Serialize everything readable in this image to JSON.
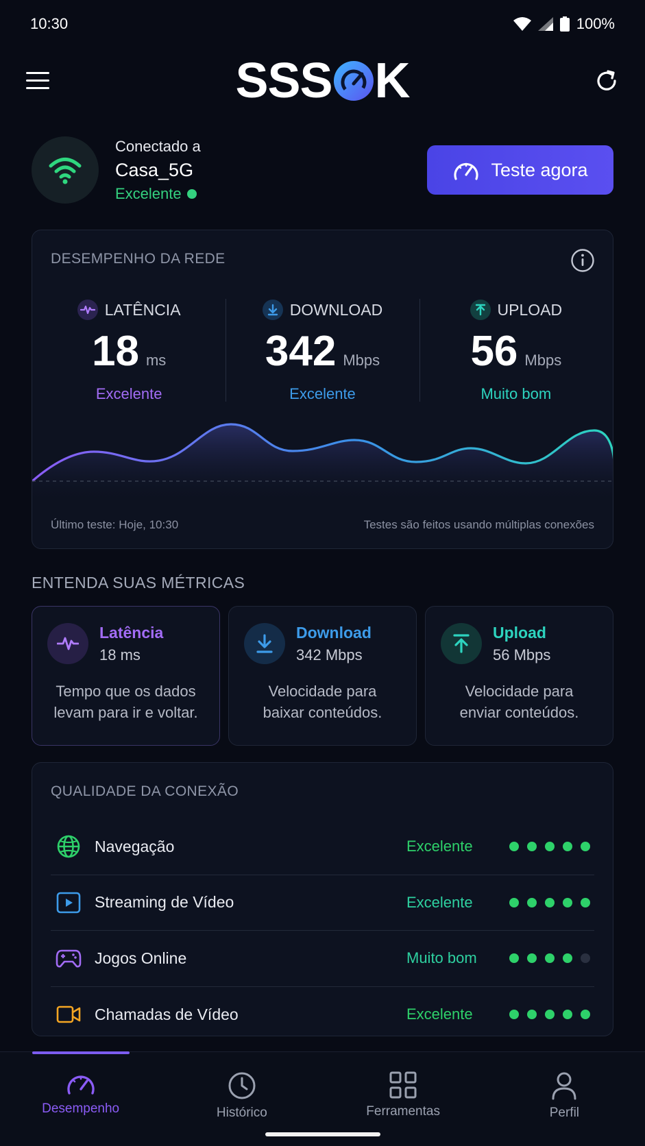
{
  "status_bar": {
    "time": "10:30",
    "battery": "100%"
  },
  "header": {
    "logo_text_left": "SSS",
    "logo_text_right": "K"
  },
  "connection": {
    "label": "Conectado a",
    "ssid": "Casa_5G",
    "status": "Excelente",
    "test_button": "Teste agora"
  },
  "performance": {
    "title": "DESEMPENHO DA REDE",
    "metrics": [
      {
        "label": "LATÊNCIA",
        "value": "18",
        "unit": "ms",
        "rating": "Excelente",
        "color": "#a26cf5"
      },
      {
        "label": "DOWNLOAD",
        "value": "342",
        "unit": "Mbps",
        "rating": "Excelente",
        "color": "#3d9be9"
      },
      {
        "label": "UPLOAD",
        "value": "56",
        "unit": "Mbps",
        "rating": "Muito bom",
        "color": "#2dd4bf"
      }
    ],
    "last_test": "Último teste: Hoje, 10:30",
    "note": "Testes são feitos usando múltiplas conexões"
  },
  "metrics_section": {
    "title": "ENTENDA SUAS MÉTRICAS",
    "cards": [
      {
        "name": "Latência",
        "value": "18 ms",
        "desc_line1": "Tempo que os dados",
        "desc_line2": "levam para ir e voltar.",
        "color": "#a26cf5"
      },
      {
        "name": "Download",
        "value": "342 Mbps",
        "desc_line1": "Velocidade para",
        "desc_line2": "baixar conteúdos.",
        "color": "#3d9be9"
      },
      {
        "name": "Upload",
        "value": "56 Mbps",
        "desc_line1": "Velocidade para",
        "desc_line2": "enviar conteúdos.",
        "color": "#2dd4bf"
      }
    ]
  },
  "quality": {
    "title": "QUALIDADE DA CONEXÃO",
    "items": [
      {
        "name": "Navegação",
        "rating": "Excelente",
        "score": 5,
        "icon": "globe-icon",
        "icon_color": "#2ed16a"
      },
      {
        "name": "Streaming de Vídeo",
        "rating": "Excelente",
        "score": 5,
        "icon": "play-icon",
        "icon_color": "#3d9be9"
      },
      {
        "name": "Jogos Online",
        "rating": "Muito bom",
        "score": 4,
        "icon": "gamepad-icon",
        "icon_color": "#a26cf5"
      },
      {
        "name": "Chamadas de Vídeo",
        "rating": "Excelente",
        "score": 5,
        "icon": "video-camera-icon",
        "icon_color": "#f5a623"
      }
    ]
  },
  "nav": {
    "items": [
      {
        "label": "Desempenho",
        "active": true
      },
      {
        "label": "Histórico",
        "active": false
      },
      {
        "label": "Ferramentas",
        "active": false
      },
      {
        "label": "Perfil",
        "active": false
      }
    ]
  }
}
